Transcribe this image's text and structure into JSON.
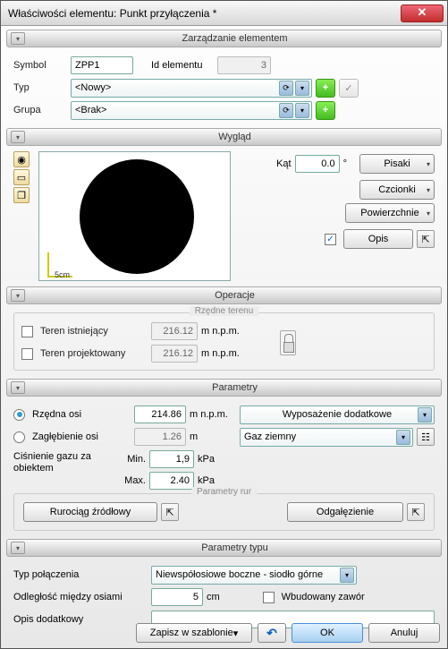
{
  "title": "Właściwości elementu: Punkt przyłączenia *",
  "sections": {
    "zarzadzanie": "Zarządzanie elementem",
    "wyglad": "Wygląd",
    "operacje": "Operacje",
    "parametry": "Parametry",
    "parametry_typu": "Parametry typu"
  },
  "management": {
    "symbol_lbl": "Symbol",
    "symbol_val": "ZPP1",
    "id_lbl": "Id elementu",
    "id_val": "3",
    "typ_lbl": "Typ",
    "typ_val": "<Nowy>",
    "grupa_lbl": "Grupa",
    "grupa_val": "<Brak>"
  },
  "look": {
    "kat_lbl": "Kąt",
    "kat_val": "0.0",
    "kat_unit": "°",
    "pisaki": "Pisaki",
    "czcionki": "Czcionki",
    "powierzchnie": "Powierzchnie",
    "opis": "Opis",
    "scale": "5cm"
  },
  "ops": {
    "rz_legend": "Rzędne terenu",
    "teren_ist": "Teren istniejący",
    "teren_ist_val": "216.12",
    "teren_proj": "Teren projektowany",
    "teren_proj_val": "216.12",
    "unit": "m n.p.m."
  },
  "params": {
    "rzedna_osi": "Rzędna osi",
    "rzedna_val": "214.86",
    "rzedna_unit": "m n.p.m.",
    "zaglebienie": "Zagłębienie osi",
    "zaglebienie_val": "1.26",
    "zaglebienie_unit": "m",
    "cisnienie": "Ciśnienie gazu za obiektem",
    "min_lbl": "Min.",
    "min_val": "1,9",
    "max_lbl": "Max.",
    "max_val": "2.40",
    "p_unit": "kPa",
    "wyposazenie": "Wyposażenie dodatkowe",
    "gaz": "Gaz ziemny",
    "rur_legend": "Parametry rur",
    "rurociag": "Rurociąg źródłowy",
    "odgalezienie": "Odgałęzienie"
  },
  "typ_params": {
    "typ_pol_lbl": "Typ połączenia",
    "typ_pol_val": "Niewspółosiowe boczne - siodło górne",
    "odl_lbl": "Odległość między osiami",
    "odl_val": "5",
    "odl_unit": "cm",
    "wbudowany": "Wbudowany zawór",
    "opis_dod": "Opis dodatkowy"
  },
  "footer": {
    "zapisz": "Zapisz w szablonie",
    "ok": "OK",
    "anuluj": "Anuluj"
  }
}
